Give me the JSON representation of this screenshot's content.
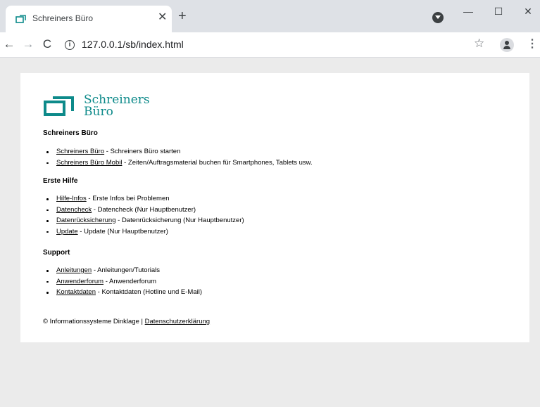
{
  "browser": {
    "tab_title": "Schreiners Büro",
    "tab_close": "✕",
    "new_tab": "+",
    "url": "127.0.0.1/sb/index.html",
    "window_controls": {
      "minimize": "—",
      "maximize": "☐",
      "close": "✕"
    },
    "nav": {
      "back": "←",
      "forward": "→",
      "reload": "C"
    },
    "icons": [
      "favicon",
      "chrome-profile-icon",
      "info-icon",
      "star-icon",
      "avatar-icon",
      "menu-icon"
    ]
  },
  "page": {
    "logo_text_line1": "Schreiners",
    "logo_text_line2": "Büro",
    "brand_color": "#0d8a8a",
    "sections": [
      {
        "heading": "Schreiners Büro",
        "items": [
          {
            "link": "Schreiners Büro",
            "desc": " - Schreiners Büro starten"
          },
          {
            "link": "Schreiners Büro Mobil",
            "desc": " - Zeiten/Auftragsmaterial buchen für Smartphones, Tablets usw."
          }
        ]
      },
      {
        "heading": "Erste Hilfe",
        "items": [
          {
            "link": "Hilfe-Infos",
            "desc": " - Erste Infos bei Problemen"
          },
          {
            "link": "Datencheck",
            "desc": " - Datencheck (Nur Hauptbenutzer)"
          },
          {
            "link": "Datenrücksicherung",
            "desc": " - Datenrücksicherung (Nur Hauptbenutzer)"
          },
          {
            "link": "Update",
            "desc": " - Update (Nur Hauptbenutzer)"
          }
        ]
      },
      {
        "heading": "Support",
        "items": [
          {
            "link": "Anleitungen",
            "desc": " - Anleitungen/Tutorials"
          },
          {
            "link": "Anwenderforum",
            "desc": " - Anwenderforum"
          },
          {
            "link": "Kontaktdaten",
            "desc": " - Kontaktdaten (Hotline und E-Mail)"
          }
        ]
      }
    ],
    "footer": {
      "copyright": "© Informationssysteme Dinklage | ",
      "privacy_link": "Datenschutzerklärung"
    }
  }
}
